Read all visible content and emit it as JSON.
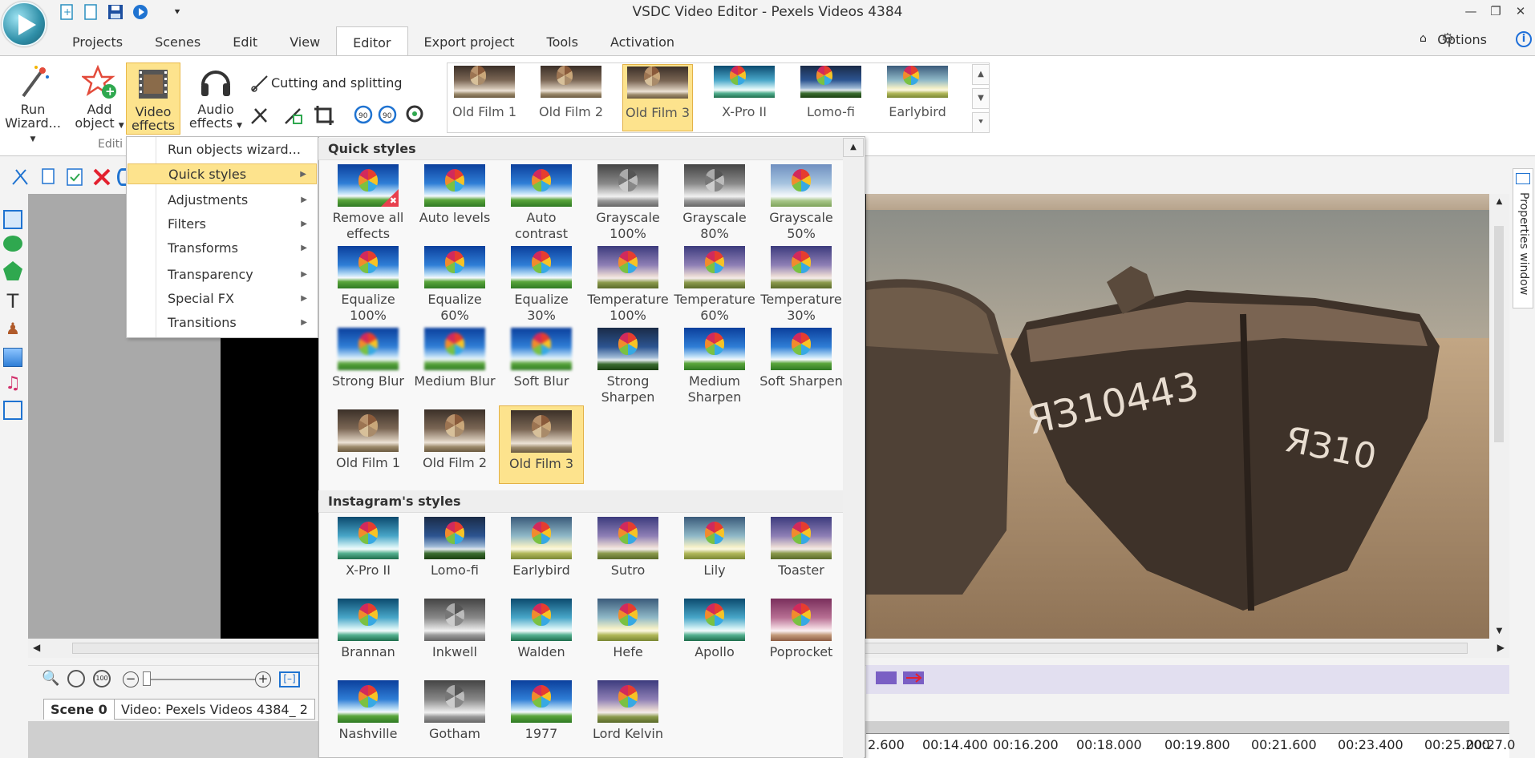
{
  "window": {
    "title": "VSDC Video Editor - Pexels Videos 4384"
  },
  "tabs": [
    {
      "label": "Projects"
    },
    {
      "label": "Scenes"
    },
    {
      "label": "Edit"
    },
    {
      "label": "View"
    },
    {
      "label": "Editor"
    },
    {
      "label": "Export project"
    },
    {
      "label": "Tools"
    },
    {
      "label": "Activation"
    }
  ],
  "active_tab": "Editor",
  "options_label": "Options",
  "ribbon": {
    "run_wizard": {
      "line1": "Run",
      "line2": "Wizard..."
    },
    "add_object": {
      "line1": "Add",
      "line2": "object"
    },
    "video_effects": {
      "line1": "Video",
      "line2": "effects"
    },
    "audio_effects": {
      "line1": "Audio",
      "line2": "effects"
    },
    "group_label": "Editi",
    "cutting_splitting": "Cutting and splitting",
    "gallery": [
      {
        "label": "Old Film 1",
        "style": "sepia"
      },
      {
        "label": "Old Film 2",
        "style": "sepia"
      },
      {
        "label": "Old Film 3",
        "style": "sepia",
        "selected": true
      },
      {
        "label": "X-Pro II",
        "style": "cool"
      },
      {
        "label": "Lomo-fi",
        "style": "dark"
      },
      {
        "label": "Earlybird",
        "style": "yellow"
      }
    ]
  },
  "menu": {
    "items": [
      {
        "label": "Run objects wizard...",
        "submenu": false
      },
      {
        "label": "Quick styles",
        "submenu": true,
        "highlighted": true
      },
      {
        "label": "Adjustments",
        "submenu": true
      },
      {
        "label": "Filters",
        "submenu": true
      },
      {
        "label": "Transforms",
        "submenu": true
      },
      {
        "label": "Transparency",
        "submenu": true
      },
      {
        "label": "Special FX",
        "submenu": true
      },
      {
        "label": "Transitions",
        "submenu": true
      }
    ]
  },
  "quick_styles": {
    "header": "Quick styles",
    "items": [
      {
        "label": "Remove all effects",
        "style": "normal",
        "badge": "remove"
      },
      {
        "label": "Auto levels",
        "style": "normal"
      },
      {
        "label": "Auto contrast",
        "style": "normal"
      },
      {
        "label": "Grayscale 100%",
        "style": "gray"
      },
      {
        "label": "Grayscale 80%",
        "style": "gray"
      },
      {
        "label": "Grayscale 50%",
        "style": "faded"
      },
      {
        "label": "Equalize 100%",
        "style": "normal"
      },
      {
        "label": "Equalize 60%",
        "style": "normal"
      },
      {
        "label": "Equalize 30%",
        "style": "normal"
      },
      {
        "label": "Temperature 100%",
        "style": "warm"
      },
      {
        "label": "Temperature 60%",
        "style": "warm"
      },
      {
        "label": "Temperature 30%",
        "style": "warm"
      },
      {
        "label": "Strong Blur",
        "style": "normal",
        "blur": true
      },
      {
        "label": "Medium Blur",
        "style": "normal",
        "blur": true
      },
      {
        "label": "Soft Blur",
        "style": "normal",
        "blur": true
      },
      {
        "label": "Strong Sharpen",
        "style": "dark"
      },
      {
        "label": "Medium Sharpen",
        "style": "normal"
      },
      {
        "label": "Soft Sharpen",
        "style": "normal"
      },
      {
        "label": "Old Film 1",
        "style": "sepia"
      },
      {
        "label": "Old Film 2",
        "style": "sepia"
      },
      {
        "label": "Old Film 3",
        "style": "sepia",
        "selected": true
      }
    ]
  },
  "instagram_styles": {
    "header": "Instagram's styles",
    "items": [
      {
        "label": "X-Pro II",
        "style": "cool"
      },
      {
        "label": "Lomo-fi",
        "style": "dark"
      },
      {
        "label": "Earlybird",
        "style": "yellow"
      },
      {
        "label": "Sutro",
        "style": "warm"
      },
      {
        "label": "Lily",
        "style": "yellow"
      },
      {
        "label": "Toaster",
        "style": "warm"
      },
      {
        "label": "Brannan",
        "style": "cool"
      },
      {
        "label": "Inkwell",
        "style": "gray"
      },
      {
        "label": "Walden",
        "style": "cool"
      },
      {
        "label": "Hefe",
        "style": "yellow"
      },
      {
        "label": "Apollo",
        "style": "cool"
      },
      {
        "label": "Poprocket",
        "style": "pink"
      },
      {
        "label": "Nashville",
        "style": "normal"
      },
      {
        "label": "Gotham",
        "style": "gray"
      },
      {
        "label": "1977",
        "style": "normal"
      },
      {
        "label": "Lord Kelvin",
        "style": "warm"
      }
    ]
  },
  "properties_window_label": "Properties window",
  "timeline": {
    "scene_tab": "Scene 0",
    "video_tab": "Video: Pexels Videos 4384_ 2",
    "ticks": [
      "2.600",
      "00:14.400",
      "00:16.200",
      "00:18.000",
      "00:19.800",
      "00:21.600",
      "00:23.400",
      "00:25.200",
      "00:27.0"
    ]
  },
  "colors": {
    "highlight": "#fde38d",
    "highlight_border": "#e3b247",
    "accent": "#1e6fd9"
  }
}
